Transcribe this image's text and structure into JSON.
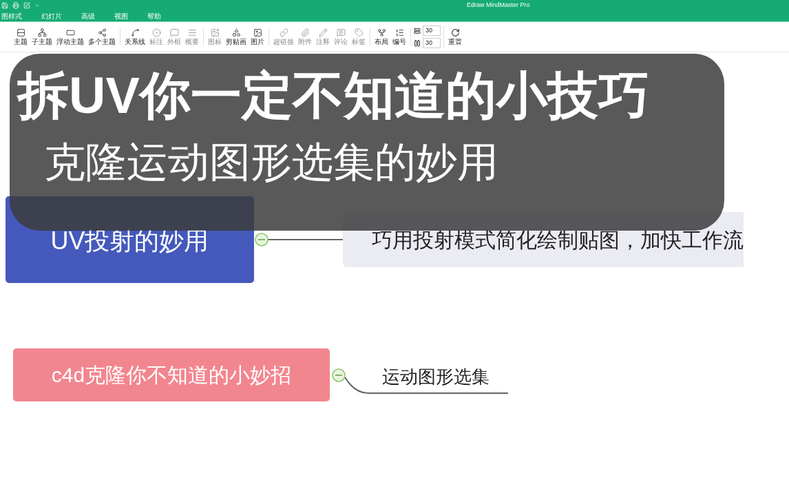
{
  "window": {
    "title": "Edraw MindMaster Pro"
  },
  "menu_tabs": [
    {
      "label": "图样式",
      "selected": false
    },
    {
      "label": "幻灯片",
      "selected": false
    },
    {
      "label": "高级",
      "selected": false
    },
    {
      "label": "视图",
      "selected": false
    },
    {
      "label": "帮助",
      "selected": false
    }
  ],
  "toolbar": {
    "groups": [
      [
        {
          "label": "主题",
          "disabled": false
        },
        {
          "label": "子主题",
          "disabled": false
        },
        {
          "label": "浮动主题",
          "disabled": false
        },
        {
          "label": "多个主题",
          "disabled": false
        }
      ],
      [
        {
          "label": "关系线",
          "disabled": false
        },
        {
          "label": "标注",
          "disabled": true
        },
        {
          "label": "外框",
          "disabled": true
        },
        {
          "label": "概要",
          "disabled": true
        }
      ],
      [
        {
          "label": "图标",
          "disabled": true
        },
        {
          "label": "剪贴画",
          "disabled": false
        },
        {
          "label": "图片",
          "disabled": false
        }
      ],
      [
        {
          "label": "超链接",
          "disabled": true
        },
        {
          "label": "附件",
          "disabled": true
        },
        {
          "label": "注释",
          "disabled": true
        },
        {
          "label": "评论",
          "disabled": true
        },
        {
          "label": "标签",
          "disabled": true
        }
      ],
      [
        {
          "label": "布局",
          "disabled": false
        },
        {
          "label": "编号",
          "disabled": false
        }
      ]
    ],
    "spacing": [
      "30",
      "30"
    ],
    "reset": "重置"
  },
  "mindmap": {
    "branches": [
      {
        "label": "UV投射的妙用",
        "color": "#4459bb",
        "child": {
          "label": "巧用投射模式简化绘制贴图，加快工作流",
          "kind": "box"
        }
      },
      {
        "label": "c4d克隆你不知道的小妙招",
        "color": "#f2868f",
        "child": {
          "label": "运动图形选集",
          "kind": "underline"
        }
      }
    ]
  },
  "overlay": {
    "title": "拆UV你一定不知道的小技巧",
    "subtitle": "克隆运动图形选集的妙用"
  }
}
